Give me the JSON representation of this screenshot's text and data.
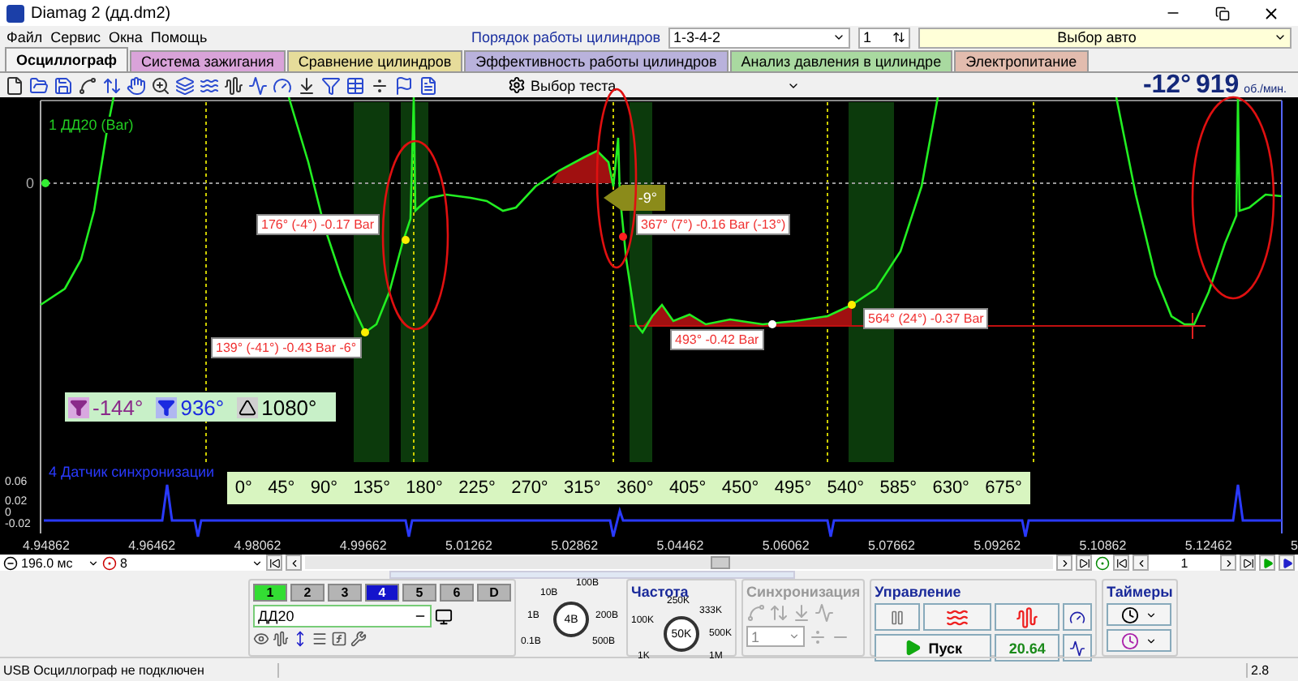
{
  "window": {
    "title": "Diamag 2 (дд.dm2)"
  },
  "menu": [
    "Файл",
    "Сервис",
    "Окна",
    "Помощь"
  ],
  "cylinder_order": {
    "label": "Порядок работы цилиндров",
    "value": "1-3-4-2",
    "spinner": "1",
    "auto_select": "Выбор авто"
  },
  "tabs": [
    {
      "label": "Осциллограф",
      "selected": true,
      "color": "#f4f4f4"
    },
    {
      "label": "Система зажигания",
      "selected": false,
      "color": "#d9a3d9"
    },
    {
      "label": "Сравнение цилиндров",
      "selected": false,
      "color": "#e6dc9a"
    },
    {
      "label": "Эффективность работы цилиндров",
      "selected": false,
      "color": "#b9b2dc"
    },
    {
      "label": "Анализ давления в цилиндре",
      "selected": false,
      "color": "#a9d9a0"
    },
    {
      "label": "Электропитание",
      "selected": false,
      "color": "#e2bcae"
    }
  ],
  "toolbar": {
    "test_select": "Выбор теста",
    "angle": "-12°",
    "rpm": "919",
    "rpm_unit": "об./мин."
  },
  "main_plot": {
    "channel_label": "1 ДД20 (Bar)",
    "zero_label": "0",
    "angle_flag": "-9°",
    "markers": [
      {
        "text": "176° (-4°) -0.17 Bar"
      },
      {
        "text": "139° (-41°) -0.43 Bar -6°"
      },
      {
        "text": "367° (7°) -0.16 Bar (-13°)"
      },
      {
        "text": "493° -0.42 Bar"
      },
      {
        "text": "564° (24°) -0.37 Bar"
      }
    ],
    "cursors": [
      {
        "kind": "start",
        "value": "-144°"
      },
      {
        "kind": "end",
        "value": "936°"
      },
      {
        "kind": "delta",
        "value": "1080°"
      }
    ]
  },
  "sync_plot": {
    "channel_label": "4 Датчик синхронизации",
    "y_ticks": [
      "0.06",
      "0.02",
      "0",
      "-0.02"
    ],
    "degree_scale": [
      "0°",
      "45°",
      "90°",
      "135°",
      "180°",
      "225°",
      "270°",
      "315°",
      "360°",
      "405°",
      "450°",
      "495°",
      "540°",
      "585°",
      "630°",
      "675°"
    ],
    "time_ticks": [
      "4.94862",
      "4.96462",
      "4.98062",
      "4.99662",
      "5.01262",
      "5.02862",
      "5.04462",
      "5.06062",
      "5.07662",
      "5.09262",
      "5.10862",
      "5.12462",
      "5"
    ]
  },
  "timeline": {
    "time_window": "196.0 мс",
    "count": "8",
    "frame": "1"
  },
  "channels": {
    "buttons": [
      {
        "label": "1",
        "color": "#33dd33"
      },
      {
        "label": "2",
        "color": "#b4b4b4"
      },
      {
        "label": "3",
        "color": "#b4b4b4"
      },
      {
        "label": "4",
        "color": "#1414cc"
      },
      {
        "label": "5",
        "color": "#b4b4b4"
      },
      {
        "label": "6",
        "color": "#b4b4b4"
      },
      {
        "label": "D",
        "color": "#b4b4b4"
      }
    ],
    "sensor": "ДД20"
  },
  "voltage_dial": {
    "labels": [
      "100В",
      "10В",
      "1В",
      "200В",
      "0.1В",
      "500В"
    ],
    "value": "4В"
  },
  "frequency": {
    "title": "Частота",
    "labels": [
      "250K",
      "333K",
      "100K",
      "500K",
      "1K",
      "1M"
    ],
    "value": "50K"
  },
  "sync": {
    "title": "Синхронизация",
    "channel": "1",
    "disabled": true
  },
  "control": {
    "title": "Управление",
    "start": "Пуск",
    "value": "20.64"
  },
  "timers": {
    "title": "Таймеры"
  },
  "status_bar": {
    "message": "USB Осциллограф не подключен",
    "version": "2.8"
  }
}
